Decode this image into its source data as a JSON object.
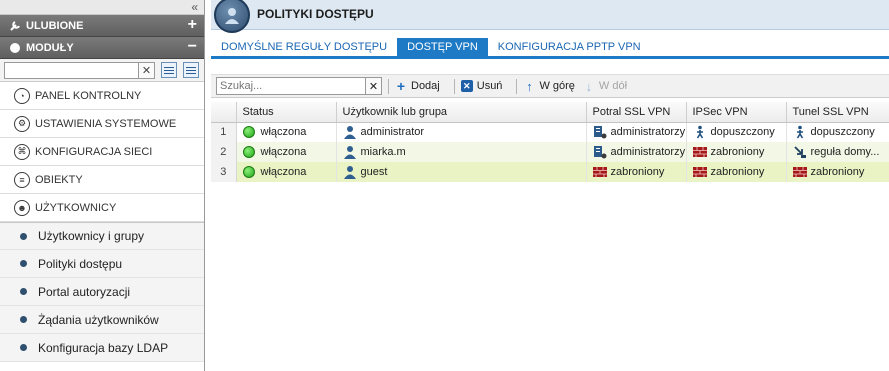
{
  "sidebar": {
    "favorites_label": "ULUBIONE",
    "modules_label": "MODUŁY",
    "search_placeholder": "",
    "nav": [
      {
        "label": "PANEL KONTROLNY",
        "icon": "dashboard-icon"
      },
      {
        "label": "USTAWIENIA SYSTEMOWE",
        "icon": "settings-icon"
      },
      {
        "label": "KONFIGURACJA SIECI",
        "icon": "network-icon"
      },
      {
        "label": "OBIEKTY",
        "icon": "objects-icon"
      },
      {
        "label": "UŻYTKOWNICY",
        "icon": "users-icon"
      }
    ],
    "sub": [
      {
        "label": "Użytkownicy i grupy"
      },
      {
        "label": "Polityki dostępu"
      },
      {
        "label": "Portal autoryzacji"
      },
      {
        "label": "Żądania użytkowników"
      },
      {
        "label": "Konfiguracja bazy LDAP"
      }
    ]
  },
  "page": {
    "title": "POLITYKI DOSTĘPU",
    "tabs": [
      {
        "label": "DOMYŚLNE REGUŁY DOSTĘPU",
        "active": false
      },
      {
        "label": "DOSTĘP VPN",
        "active": true
      },
      {
        "label": "KONFIGURACJA PPTP VPN",
        "active": false
      }
    ]
  },
  "toolbar": {
    "search_placeholder": "Szukaj...",
    "add_label": "Dodaj",
    "delete_label": "Usuń",
    "up_label": "W górę",
    "down_label": "W dół"
  },
  "grid": {
    "columns": [
      "",
      "Status",
      "Użytkownik lub grupa",
      "Potral SSL VPN",
      "IPSec VPN",
      "Tunel SSL VPN"
    ],
    "rows": [
      {
        "num": "1",
        "status": "włączona",
        "user": "administrator",
        "portal": "administratorzy",
        "portal_icon": "admin-icon",
        "ipsec": "dopuszczony",
        "ipsec_icon": "allowed-icon",
        "tunnel": "dopuszczony",
        "tunnel_icon": "allowed-icon"
      },
      {
        "num": "2",
        "status": "włączona",
        "user": "miarka.m",
        "portal": "administratorzy",
        "portal_icon": "admin-icon",
        "ipsec": "zabroniony",
        "ipsec_icon": "denied-icon",
        "tunnel": "reguła domy...",
        "tunnel_icon": "default-rule-icon"
      },
      {
        "num": "3",
        "status": "włączona",
        "user": "guest",
        "portal": "zabroniony",
        "portal_icon": "denied-icon",
        "ipsec": "zabroniony",
        "ipsec_icon": "denied-icon",
        "tunnel": "zabroniony",
        "tunnel_icon": "denied-icon"
      }
    ]
  }
}
